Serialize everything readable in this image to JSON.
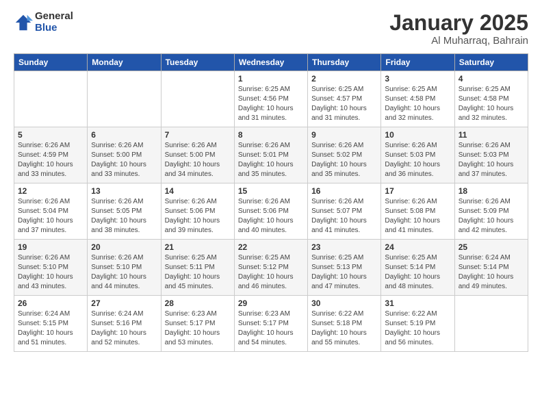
{
  "logo": {
    "general": "General",
    "blue": "Blue"
  },
  "title": "January 2025",
  "location": "Al Muharraq, Bahrain",
  "days_header": [
    "Sunday",
    "Monday",
    "Tuesday",
    "Wednesday",
    "Thursday",
    "Friday",
    "Saturday"
  ],
  "weeks": [
    [
      {
        "day": "",
        "info": ""
      },
      {
        "day": "",
        "info": ""
      },
      {
        "day": "",
        "info": ""
      },
      {
        "day": "1",
        "sunrise": "Sunrise: 6:25 AM",
        "sunset": "Sunset: 4:56 PM",
        "daylight": "Daylight: 10 hours and 31 minutes."
      },
      {
        "day": "2",
        "sunrise": "Sunrise: 6:25 AM",
        "sunset": "Sunset: 4:57 PM",
        "daylight": "Daylight: 10 hours and 31 minutes."
      },
      {
        "day": "3",
        "sunrise": "Sunrise: 6:25 AM",
        "sunset": "Sunset: 4:58 PM",
        "daylight": "Daylight: 10 hours and 32 minutes."
      },
      {
        "day": "4",
        "sunrise": "Sunrise: 6:25 AM",
        "sunset": "Sunset: 4:58 PM",
        "daylight": "Daylight: 10 hours and 32 minutes."
      }
    ],
    [
      {
        "day": "5",
        "sunrise": "Sunrise: 6:26 AM",
        "sunset": "Sunset: 4:59 PM",
        "daylight": "Daylight: 10 hours and 33 minutes."
      },
      {
        "day": "6",
        "sunrise": "Sunrise: 6:26 AM",
        "sunset": "Sunset: 5:00 PM",
        "daylight": "Daylight: 10 hours and 33 minutes."
      },
      {
        "day": "7",
        "sunrise": "Sunrise: 6:26 AM",
        "sunset": "Sunset: 5:00 PM",
        "daylight": "Daylight: 10 hours and 34 minutes."
      },
      {
        "day": "8",
        "sunrise": "Sunrise: 6:26 AM",
        "sunset": "Sunset: 5:01 PM",
        "daylight": "Daylight: 10 hours and 35 minutes."
      },
      {
        "day": "9",
        "sunrise": "Sunrise: 6:26 AM",
        "sunset": "Sunset: 5:02 PM",
        "daylight": "Daylight: 10 hours and 35 minutes."
      },
      {
        "day": "10",
        "sunrise": "Sunrise: 6:26 AM",
        "sunset": "Sunset: 5:03 PM",
        "daylight": "Daylight: 10 hours and 36 minutes."
      },
      {
        "day": "11",
        "sunrise": "Sunrise: 6:26 AM",
        "sunset": "Sunset: 5:03 PM",
        "daylight": "Daylight: 10 hours and 37 minutes."
      }
    ],
    [
      {
        "day": "12",
        "sunrise": "Sunrise: 6:26 AM",
        "sunset": "Sunset: 5:04 PM",
        "daylight": "Daylight: 10 hours and 37 minutes."
      },
      {
        "day": "13",
        "sunrise": "Sunrise: 6:26 AM",
        "sunset": "Sunset: 5:05 PM",
        "daylight": "Daylight: 10 hours and 38 minutes."
      },
      {
        "day": "14",
        "sunrise": "Sunrise: 6:26 AM",
        "sunset": "Sunset: 5:06 PM",
        "daylight": "Daylight: 10 hours and 39 minutes."
      },
      {
        "day": "15",
        "sunrise": "Sunrise: 6:26 AM",
        "sunset": "Sunset: 5:06 PM",
        "daylight": "Daylight: 10 hours and 40 minutes."
      },
      {
        "day": "16",
        "sunrise": "Sunrise: 6:26 AM",
        "sunset": "Sunset: 5:07 PM",
        "daylight": "Daylight: 10 hours and 41 minutes."
      },
      {
        "day": "17",
        "sunrise": "Sunrise: 6:26 AM",
        "sunset": "Sunset: 5:08 PM",
        "daylight": "Daylight: 10 hours and 41 minutes."
      },
      {
        "day": "18",
        "sunrise": "Sunrise: 6:26 AM",
        "sunset": "Sunset: 5:09 PM",
        "daylight": "Daylight: 10 hours and 42 minutes."
      }
    ],
    [
      {
        "day": "19",
        "sunrise": "Sunrise: 6:26 AM",
        "sunset": "Sunset: 5:10 PM",
        "daylight": "Daylight: 10 hours and 43 minutes."
      },
      {
        "day": "20",
        "sunrise": "Sunrise: 6:26 AM",
        "sunset": "Sunset: 5:10 PM",
        "daylight": "Daylight: 10 hours and 44 minutes."
      },
      {
        "day": "21",
        "sunrise": "Sunrise: 6:25 AM",
        "sunset": "Sunset: 5:11 PM",
        "daylight": "Daylight: 10 hours and 45 minutes."
      },
      {
        "day": "22",
        "sunrise": "Sunrise: 6:25 AM",
        "sunset": "Sunset: 5:12 PM",
        "daylight": "Daylight: 10 hours and 46 minutes."
      },
      {
        "day": "23",
        "sunrise": "Sunrise: 6:25 AM",
        "sunset": "Sunset: 5:13 PM",
        "daylight": "Daylight: 10 hours and 47 minutes."
      },
      {
        "day": "24",
        "sunrise": "Sunrise: 6:25 AM",
        "sunset": "Sunset: 5:14 PM",
        "daylight": "Daylight: 10 hours and 48 minutes."
      },
      {
        "day": "25",
        "sunrise": "Sunrise: 6:24 AM",
        "sunset": "Sunset: 5:14 PM",
        "daylight": "Daylight: 10 hours and 49 minutes."
      }
    ],
    [
      {
        "day": "26",
        "sunrise": "Sunrise: 6:24 AM",
        "sunset": "Sunset: 5:15 PM",
        "daylight": "Daylight: 10 hours and 51 minutes."
      },
      {
        "day": "27",
        "sunrise": "Sunrise: 6:24 AM",
        "sunset": "Sunset: 5:16 PM",
        "daylight": "Daylight: 10 hours and 52 minutes."
      },
      {
        "day": "28",
        "sunrise": "Sunrise: 6:23 AM",
        "sunset": "Sunset: 5:17 PM",
        "daylight": "Daylight: 10 hours and 53 minutes."
      },
      {
        "day": "29",
        "sunrise": "Sunrise: 6:23 AM",
        "sunset": "Sunset: 5:17 PM",
        "daylight": "Daylight: 10 hours and 54 minutes."
      },
      {
        "day": "30",
        "sunrise": "Sunrise: 6:22 AM",
        "sunset": "Sunset: 5:18 PM",
        "daylight": "Daylight: 10 hours and 55 minutes."
      },
      {
        "day": "31",
        "sunrise": "Sunrise: 6:22 AM",
        "sunset": "Sunset: 5:19 PM",
        "daylight": "Daylight: 10 hours and 56 minutes."
      },
      {
        "day": "",
        "info": ""
      }
    ]
  ]
}
